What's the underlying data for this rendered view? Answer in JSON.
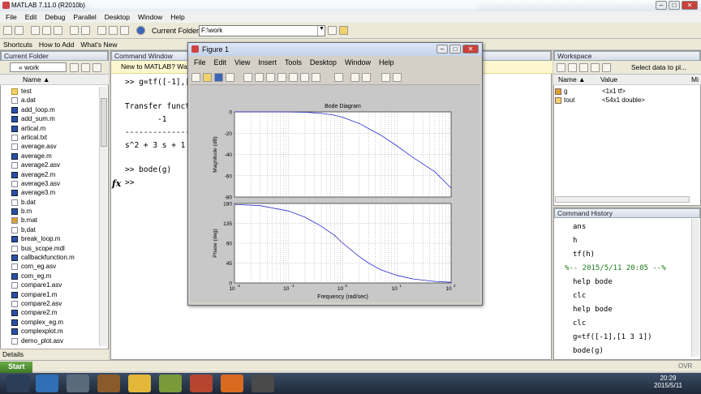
{
  "window": {
    "title": "MATLAB  7.11.0 (R2010b)"
  },
  "menu": [
    "File",
    "Edit",
    "Debug",
    "Parallel",
    "Desktop",
    "Window",
    "Help"
  ],
  "toolbar": {
    "current_folder_label": "Current Folder:",
    "current_folder_value": "F:\\work"
  },
  "shortcuts": [
    "Shortcuts",
    "How to Add",
    "What's New"
  ],
  "current_folder": {
    "title": "Current Folder",
    "path": "« work",
    "column": "Name ▲",
    "files": [
      "test",
      "a.dat",
      "add_loop.m",
      "add_sum.m",
      "artical.m",
      "artical.txt",
      "average.asv",
      "average.m",
      "average2.asv",
      "average2.m",
      "average3.asv",
      "average3.m",
      "b.dat",
      "b.m",
      "b.mat",
      "b,dat",
      "break_loop.m",
      "bus_scope.mdl",
      "callbackfunction.m",
      "com_eg.asv",
      "com_eg.m",
      "compare1.asv",
      "compare1.m",
      "compare2.asv",
      "compare2.m",
      "complex_eg.m",
      "complexplot.m",
      "demo_plot.asv"
    ],
    "details": "Details"
  },
  "command_window": {
    "title": "Command Window",
    "banner": "New to MATLAB? Wat",
    "lines": [
      ">> g=tf([-1],[1",
      "",
      "Transfer functio",
      "       -1",
      "--------------",
      "s^2 + 3 s + 1",
      "",
      ">> bode(g)",
      ">>"
    ],
    "fx": "fx"
  },
  "workspace": {
    "title": "Workspace",
    "select_label": "Select data to pl...",
    "columns": [
      "Name ▲",
      "Value",
      "Mi"
    ],
    "vars": [
      {
        "name": "g",
        "value": "<1x1 tf>"
      },
      {
        "name": "tout",
        "value": "<54x1 double>"
      }
    ]
  },
  "command_history": {
    "title": "Command History",
    "lines": [
      "ans",
      "h",
      "tf(h)",
      "%-- 2015/5/11 20:05 --%",
      "help bode",
      "clc",
      "help bode",
      "clc",
      "g=tf([-1],[1 3 1])",
      "bode(g)"
    ]
  },
  "figure": {
    "title": "Figure 1",
    "menu": [
      "File",
      "Edit",
      "View",
      "Insert",
      "Tools",
      "Desktop",
      "Window",
      "Help"
    ]
  },
  "chart_data": {
    "type": "line",
    "title": "Bode Diagram",
    "xlabel": "Frequency  (rad/sec)",
    "xscale": "log",
    "xlim": [
      0.01,
      100
    ],
    "x_ticks": [
      "10",
      "10",
      "10",
      "10",
      "10"
    ],
    "x_tick_exponents": [
      "-2",
      "-1",
      "0",
      "1",
      "2"
    ],
    "subplots": [
      {
        "ylabel": "Magnitude (dB)",
        "ylim": [
          -80,
          0
        ],
        "y_ticks": [
          "0",
          "-20",
          "-40",
          "-60",
          "-80"
        ],
        "x": [
          0.01,
          0.03,
          0.1,
          0.2,
          0.38,
          0.7,
          1,
          2,
          3,
          5,
          10,
          20,
          50,
          100
        ],
        "y": [
          0,
          -0.01,
          -0.09,
          -0.35,
          -1.2,
          -3.1,
          -5.1,
          -10.8,
          -15.7,
          -21.8,
          -32.0,
          -43.0,
          -56.2,
          -71.6
        ]
      },
      {
        "ylabel": "Phase (deg)",
        "ylim": [
          0,
          180
        ],
        "y_ticks": [
          "180",
          "135",
          "90",
          "45",
          "0"
        ],
        "x": [
          0.01,
          0.03,
          0.1,
          0.2,
          0.38,
          0.7,
          1,
          2,
          3,
          5,
          10,
          20,
          50,
          100
        ],
        "y": [
          178,
          175,
          163,
          149,
          130,
          108,
          90,
          60,
          45,
          30,
          17,
          9,
          3.5,
          1.5
        ]
      }
    ],
    "grid": true
  },
  "status": {
    "ovr": "OVR"
  },
  "taskbar": {
    "start": "Start",
    "time": "20:29",
    "date": "2015/5/11"
  }
}
